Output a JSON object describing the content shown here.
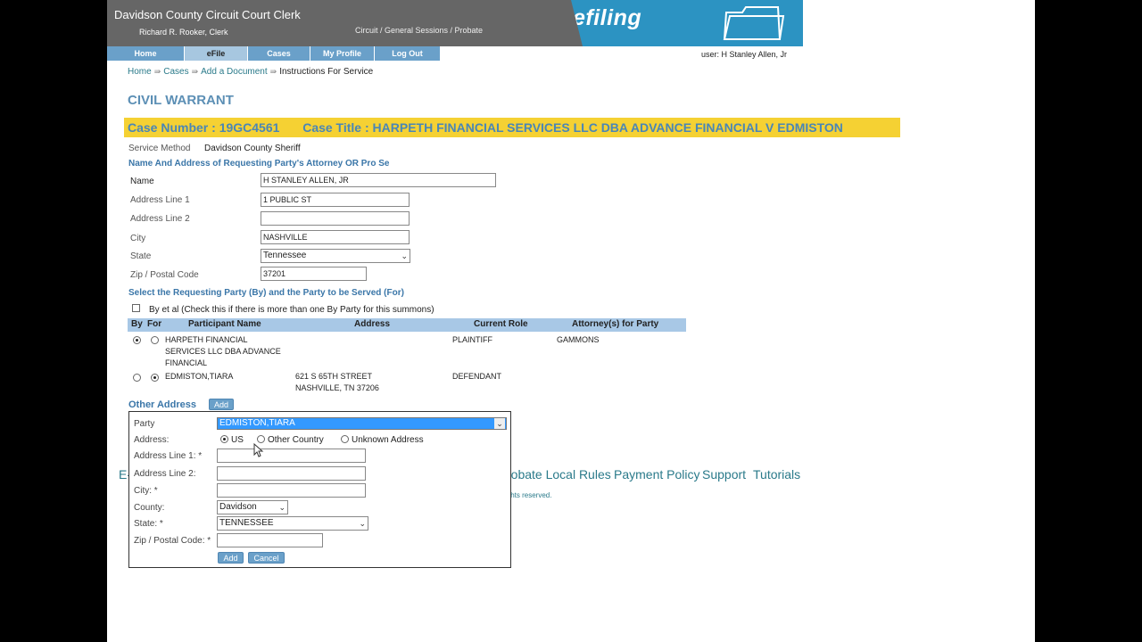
{
  "header": {
    "court_name": "Davidson County Circuit Court Clerk",
    "clerk_name": "Richard R. Rooker, Clerk",
    "divisions": "Circuit / General Sessions / Probate",
    "brand": "efiling",
    "brand_color": "#2c93c2"
  },
  "nav": {
    "tabs": [
      {
        "label": "Home"
      },
      {
        "label": "eFile"
      },
      {
        "label": "Cases"
      },
      {
        "label": "My Profile"
      },
      {
        "label": "Log Out"
      }
    ],
    "active": "eFile"
  },
  "user": "user: H Stanley Allen, Jr",
  "breadcrumb": [
    "Home",
    "Cases",
    "Add a Document",
    "Instructions For Service"
  ],
  "page_title": "CIVIL WARRANT",
  "case": {
    "number_label": "Case Number : 19GC4561",
    "title_label": "Case Title : HARPETH FINANCIAL SERVICES LLC DBA ADVANCE FINANCIAL V EDMISTON"
  },
  "service": {
    "method_label": "Service Method",
    "method_value": "Davidson County Sheriff"
  },
  "attorney_section": {
    "heading": "Name And Address of Requesting Party's Attorney OR Pro Se",
    "fields": {
      "name_label": "Name",
      "name": "H STANLEY ALLEN, JR",
      "addr1_label": "Address Line 1",
      "addr1": "1 PUBLIC ST",
      "addr2_label": "Address Line 2",
      "addr2": "",
      "city_label": "City",
      "city": "NASHVILLE",
      "state_label": "State",
      "state": "Tennessee",
      "zip_label": "Zip / Postal Code",
      "zip": "37201"
    }
  },
  "party_section": {
    "heading": "Select the Requesting Party (By) and the Party to be Served (For)",
    "et_al": "By et al (Check this if there is more than one By Party for this summons)",
    "columns": [
      "By",
      "For",
      "Participant Name",
      "Address",
      "Current Role",
      "Attorney(s) for Party"
    ],
    "rows": [
      {
        "name": [
          "HARPETH FINANCIAL",
          "SERVICES LLC DBA ADVANCE",
          "FINANCIAL"
        ],
        "address": [
          "",
          ""
        ],
        "role": "PLAINTIFF",
        "attorney": "GAMMONS",
        "by": true,
        "for": false
      },
      {
        "name": [
          "EDMISTON,TIARA"
        ],
        "address": [
          "621 S 65TH STREET",
          "NASHVILLE, TN 37206"
        ],
        "role": "DEFENDANT",
        "attorney": "",
        "by": false,
        "for": true
      }
    ]
  },
  "other_address": {
    "heading": "Other Address",
    "add_button": "Add"
  },
  "footer": {
    "links": [
      "E-",
      "robate Local Rules",
      "Payment Policy",
      "Support",
      "Tutorials"
    ],
    "copyright": "ights reserved."
  },
  "popup": {
    "party_label": "Party",
    "party_value": "EDMISTON,TIARA",
    "address_label": "Address:",
    "address_options": [
      "US",
      "Other Country",
      "Unknown Address"
    ],
    "address_selected": "US",
    "addr1_label": "Address Line 1: *",
    "addr2_label": "Address Line 2:",
    "city_label": "City: *",
    "county_label": "County:",
    "county_value": "Davidson",
    "state_label": "State: *",
    "state_value": "TENNESSEE",
    "zip_label": "Zip / Postal Code: *",
    "add_button": "Add",
    "cancel_button": "Cancel"
  }
}
